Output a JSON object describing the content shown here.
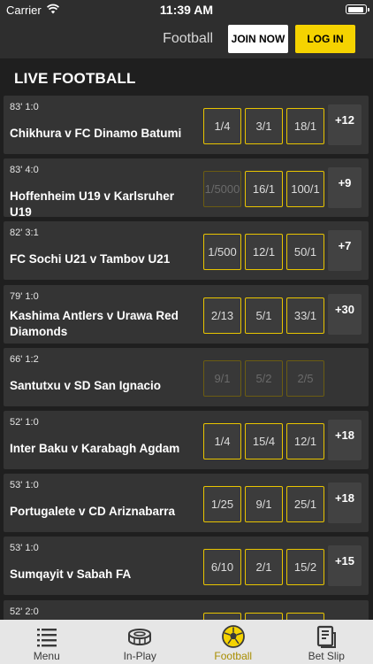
{
  "status_bar": {
    "carrier": "Carrier",
    "time": "11:39 AM"
  },
  "header": {
    "title": "Football",
    "join_label": "JOIN NOW",
    "login_label": "LOG IN"
  },
  "section_title": "LIVE FOOTBALL",
  "accent_color": "#f5d300",
  "matches": [
    {
      "clock": "83' 1:0",
      "teams": "Chikhura v FC Dinamo Batumi",
      "odds": [
        "1/4",
        "3/1",
        "18/1"
      ],
      "disabled": [
        false,
        false,
        false
      ],
      "more": "+12"
    },
    {
      "clock": "83' 4:0",
      "teams": "Hoffenheim U19 v Karlsruher U19",
      "odds": [
        "1/5000",
        "16/1",
        "100/1"
      ],
      "disabled": [
        true,
        false,
        false
      ],
      "more": "+9"
    },
    {
      "clock": "82' 3:1",
      "teams": "FC Sochi U21 v Tambov U21",
      "odds": [
        "1/500",
        "12/1",
        "50/1"
      ],
      "disabled": [
        false,
        false,
        false
      ],
      "more": "+7"
    },
    {
      "clock": "79' 1:0",
      "teams": "Kashima Antlers v Urawa Red Diamonds",
      "odds": [
        "2/13",
        "5/1",
        "33/1"
      ],
      "disabled": [
        false,
        false,
        false
      ],
      "more": "+30"
    },
    {
      "clock": "66' 1:2",
      "teams": "Santutxu v SD San Ignacio",
      "odds": [
        "9/1",
        "5/2",
        "2/5"
      ],
      "disabled": [
        true,
        true,
        true
      ],
      "more": ""
    },
    {
      "clock": "52' 1:0",
      "teams": "Inter Baku v Karabagh Agdam",
      "odds": [
        "1/4",
        "15/4",
        "12/1"
      ],
      "disabled": [
        false,
        false,
        false
      ],
      "more": "+18"
    },
    {
      "clock": "53' 1:0",
      "teams": "Portugalete v CD Ariznabarra",
      "odds": [
        "1/25",
        "9/1",
        "25/1"
      ],
      "disabled": [
        false,
        false,
        false
      ],
      "more": "+18"
    },
    {
      "clock": "53' 1:0",
      "teams": "Sumqayit v Sabah FA",
      "odds": [
        "6/10",
        "2/1",
        "15/2"
      ],
      "disabled": [
        false,
        false,
        false
      ],
      "more": "+15"
    },
    {
      "clock": "52' 2:0",
      "teams": "",
      "odds": [
        "",
        "",
        ""
      ],
      "disabled": [
        false,
        false,
        false
      ],
      "more": ""
    }
  ],
  "tabs": [
    {
      "label": "Menu",
      "icon": "menu-icon",
      "active": false
    },
    {
      "label": "In-Play",
      "icon": "stadium-icon",
      "active": false
    },
    {
      "label": "Football",
      "icon": "football-icon",
      "active": true
    },
    {
      "label": "Bet Slip",
      "icon": "betslip-icon",
      "active": false
    }
  ]
}
